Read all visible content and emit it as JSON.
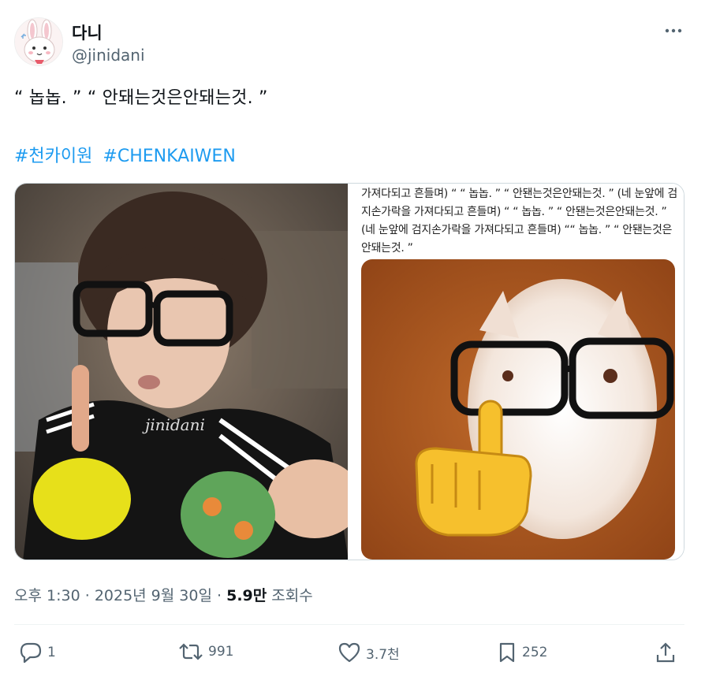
{
  "author": {
    "display_name": "다니",
    "handle": "@jinidani"
  },
  "tweet": {
    "text": "“ 놉놉. ” “ 안돼는것은안돼는것. ”",
    "hashtags": [
      "#천카이원",
      "#CHENKAIWEN"
    ]
  },
  "media": {
    "left_image": {
      "alt": "photo of person with glasses raising index finger",
      "watermark": "jinidani"
    },
    "right_image": {
      "caption": "가져다되고 흔들며) “ “ 놉놉. ” “ 안됀는것은안돼는것. ” (네 눈앞에 검지손가락을 가져다되고 흔들며) “ “ 놉놉. ” “ 안됀는것은안돼는것. ” (네 눈앞에 검지손가락을 가져다되고 흔들며) ““ 놉놉. ” “ 안됀는것은안돼는것. ”",
      "alt": "cat with glasses and pointing-up finger emoji"
    }
  },
  "meta": {
    "time": "오후 1:30",
    "date": "2025년 9월 30일",
    "views_count": "5.9만",
    "views_label": "조회수",
    "separator": "·"
  },
  "actions": {
    "replies": "1",
    "reposts": "991",
    "likes": "3.7천",
    "bookmarks": "252"
  },
  "icons": {
    "more": "more-icon",
    "reply": "reply-icon",
    "repost": "repost-icon",
    "like": "like-icon",
    "bookmark": "bookmark-icon",
    "share": "share-icon"
  },
  "colors": {
    "link": "#1d9bf0",
    "secondary_text": "#536471",
    "primary_text": "#0f1419"
  }
}
